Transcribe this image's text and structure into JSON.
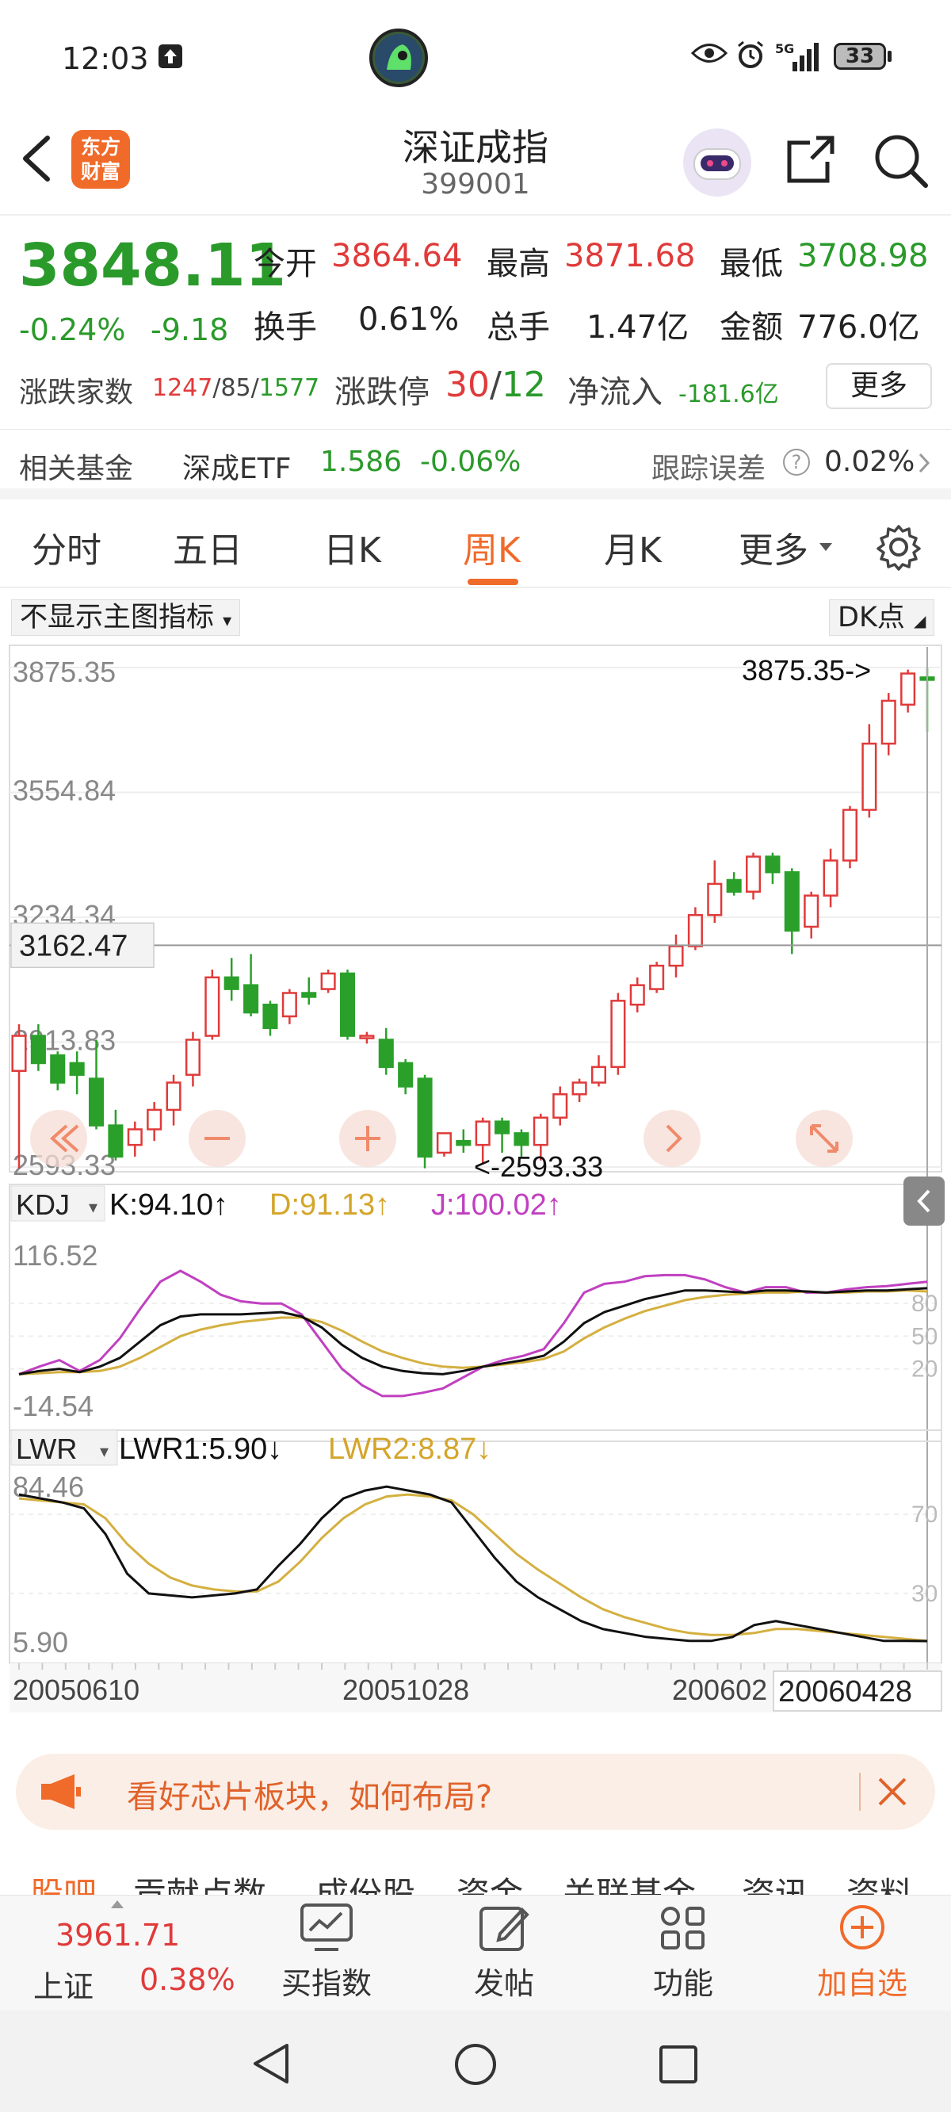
{
  "status_bar": {
    "time": "12:03",
    "battery": "33",
    "network": "5G"
  },
  "header": {
    "title": "深证成指",
    "code": "399001",
    "logo_text": "东方财富"
  },
  "quote": {
    "price": "3848.11",
    "change_pct": "-0.24%",
    "change": "-9.18",
    "open_label": "今开",
    "open": "3864.64",
    "high_label": "最高",
    "high": "3871.68",
    "low_label": "最低",
    "low": "3708.98",
    "turnover_label": "换手",
    "turnover": "0.61%",
    "volume_label": "总手",
    "volume": "1.47亿",
    "amount_label": "金额",
    "amount": "776.0亿",
    "updown_label": "涨跌家数",
    "up": "1247",
    "flat": "85",
    "down": "1577",
    "limit_label": "涨跌停",
    "limit_up": "30",
    "limit_down": "12",
    "inflow_label": "净流入",
    "inflow": "-181.6亿",
    "more_label": "更多"
  },
  "fund": {
    "label": "相关基金",
    "name": "深成ETF",
    "price": "1.586",
    "change": "-0.06%",
    "track_label": "跟踪误差",
    "track_value": "0.02%"
  },
  "tabs": [
    "分时",
    "五日",
    "日K",
    "周K",
    "月K",
    "更多"
  ],
  "active_tab": "周K",
  "indicator_select": "不显示主图指标",
  "dk_label": "DK点",
  "chart_data": {
    "type": "candlestick",
    "y_labels": [
      "3875.35",
      "3554.84",
      "3234.34",
      "2913.83",
      "2593.33"
    ],
    "ylim": [
      2593.33,
      3875.35
    ],
    "crosshair_value": "3162.47",
    "max_annotation": "3875.35->",
    "min_annotation": "<-2593.33",
    "x_labels": [
      "20050610",
      "20051028",
      "200602",
      "20060428"
    ],
    "candles": [
      [
        2840,
        2930,
        2590,
        2960
      ],
      [
        2930,
        2860,
        2840,
        2960
      ],
      [
        2880,
        2810,
        2790,
        2890
      ],
      [
        2860,
        2830,
        2780,
        2890
      ],
      [
        2820,
        2700,
        2690,
        2920
      ],
      [
        2700,
        2620,
        2610,
        2740
      ],
      [
        2650,
        2690,
        2620,
        2710
      ],
      [
        2690,
        2740,
        2660,
        2760
      ],
      [
        2740,
        2810,
        2700,
        2830
      ],
      [
        2830,
        2920,
        2800,
        2940
      ],
      [
        2930,
        3080,
        2920,
        3100
      ],
      [
        3080,
        3050,
        3020,
        3130
      ],
      [
        3060,
        2990,
        2980,
        3140
      ],
      [
        3010,
        2950,
        2930,
        3020
      ],
      [
        2980,
        3040,
        2960,
        3050
      ],
      [
        3040,
        3030,
        3010,
        3080
      ],
      [
        3050,
        3090,
        3040,
        3100
      ],
      [
        3090,
        2930,
        2920,
        3100
      ],
      [
        2930,
        2930,
        2910,
        2940
      ],
      [
        2920,
        2850,
        2830,
        2950
      ],
      [
        2860,
        2800,
        2780,
        2870
      ],
      [
        2820,
        2620,
        2590,
        2830
      ],
      [
        2630,
        2680,
        2620,
        2680
      ],
      [
        2660,
        2650,
        2630,
        2690
      ],
      [
        2650,
        2710,
        2600,
        2720
      ],
      [
        2710,
        2680,
        2630,
        2720
      ],
      [
        2680,
        2650,
        2620,
        2690
      ],
      [
        2650,
        2720,
        2610,
        2730
      ],
      [
        2720,
        2780,
        2700,
        2800
      ],
      [
        2780,
        2810,
        2760,
        2820
      ],
      [
        2810,
        2850,
        2800,
        2880
      ],
      [
        2850,
        3020,
        2830,
        3040
      ],
      [
        3010,
        3060,
        2990,
        3080
      ],
      [
        3050,
        3110,
        3040,
        3120
      ],
      [
        3110,
        3160,
        3080,
        3190
      ],
      [
        3160,
        3240,
        3150,
        3260
      ],
      [
        3240,
        3320,
        3220,
        3380
      ],
      [
        3330,
        3300,
        3290,
        3350
      ],
      [
        3300,
        3390,
        3280,
        3400
      ],
      [
        3390,
        3350,
        3320,
        3400
      ],
      [
        3350,
        3200,
        3140,
        3360
      ],
      [
        3210,
        3290,
        3180,
        3300
      ],
      [
        3290,
        3380,
        3260,
        3410
      ],
      [
        3380,
        3510,
        3360,
        3520
      ],
      [
        3510,
        3680,
        3490,
        3730
      ],
      [
        3680,
        3790,
        3650,
        3810
      ],
      [
        3780,
        3860,
        3760,
        3870
      ],
      [
        3850,
        3848,
        3710,
        3875
      ]
    ],
    "kdj": {
      "label": "KDJ",
      "k_text": "K:94.10↑",
      "d_text": "D:91.13↑",
      "j_text": "J:100.02↑",
      "y_labels": [
        "116.52",
        "-14.54"
      ],
      "right_labels": [
        "80",
        "50",
        "20"
      ],
      "ylim": [
        -14.54,
        116.52
      ],
      "k": [
        15,
        18,
        20,
        17,
        22,
        30,
        45,
        60,
        68,
        70,
        70,
        70,
        71,
        72,
        68,
        58,
        42,
        30,
        22,
        18,
        16,
        15,
        18,
        22,
        25,
        28,
        32,
        45,
        62,
        72,
        78,
        84,
        88,
        92,
        92,
        91,
        90,
        92,
        92,
        91,
        90,
        91,
        92,
        92,
        93,
        94
      ],
      "d": [
        15,
        16,
        17,
        17,
        18,
        22,
        30,
        40,
        50,
        56,
        60,
        63,
        65,
        67,
        67,
        63,
        55,
        45,
        36,
        30,
        25,
        22,
        21,
        22,
        24,
        26,
        29,
        36,
        48,
        58,
        66,
        73,
        78,
        83,
        86,
        88,
        89,
        90,
        90,
        91,
        90,
        90,
        91,
        91,
        92,
        91
      ],
      "j": [
        15,
        22,
        28,
        18,
        28,
        48,
        75,
        100,
        110,
        100,
        88,
        82,
        80,
        80,
        70,
        45,
        20,
        5,
        -5,
        -5,
        -2,
        2,
        12,
        22,
        28,
        32,
        38,
        62,
        90,
        98,
        100,
        105,
        106,
        106,
        102,
        95,
        90,
        95,
        95,
        90,
        90,
        93,
        95,
        96,
        98,
        100
      ]
    },
    "lwr": {
      "label": "LWR",
      "lwr1_text": "LWR1:5.90↓",
      "lwr2_text": "LWR2:8.87↓",
      "y_labels": [
        "84.46",
        "5.90"
      ],
      "right_labels": [
        "70",
        "30"
      ],
      "ylim": [
        5.9,
        84.46
      ],
      "lwr1": [
        80,
        78,
        76,
        73,
        60,
        40,
        30,
        29,
        28,
        29,
        30,
        32,
        44,
        55,
        68,
        78,
        82,
        84,
        82,
        80,
        76,
        62,
        48,
        36,
        28,
        22,
        16,
        12,
        10,
        8,
        7,
        6,
        6,
        8,
        14,
        16,
        14,
        12,
        10,
        8,
        6,
        6,
        5.9
      ],
      "lwr2": [
        78,
        77,
        76,
        75,
        68,
        55,
        45,
        38,
        34,
        32,
        31,
        31,
        36,
        46,
        58,
        68,
        75,
        79,
        80,
        79,
        77,
        70,
        60,
        50,
        42,
        35,
        28,
        22,
        18,
        15,
        12,
        10,
        9,
        9,
        10,
        12,
        12,
        11,
        10,
        9,
        8,
        7,
        6
      ]
    }
  },
  "banner": {
    "text": "看好芯片板块，如何布局?"
  },
  "subtabs": [
    "股吧",
    "贡献点数",
    "成份股",
    "资金",
    "关联基金",
    "资讯",
    "资料"
  ],
  "bottom_nav": {
    "index_price": "3961.71",
    "index_name": "上证",
    "index_change": "0.38%",
    "buy": "买指数",
    "post": "发帖",
    "func": "功能",
    "add": "加自选"
  }
}
